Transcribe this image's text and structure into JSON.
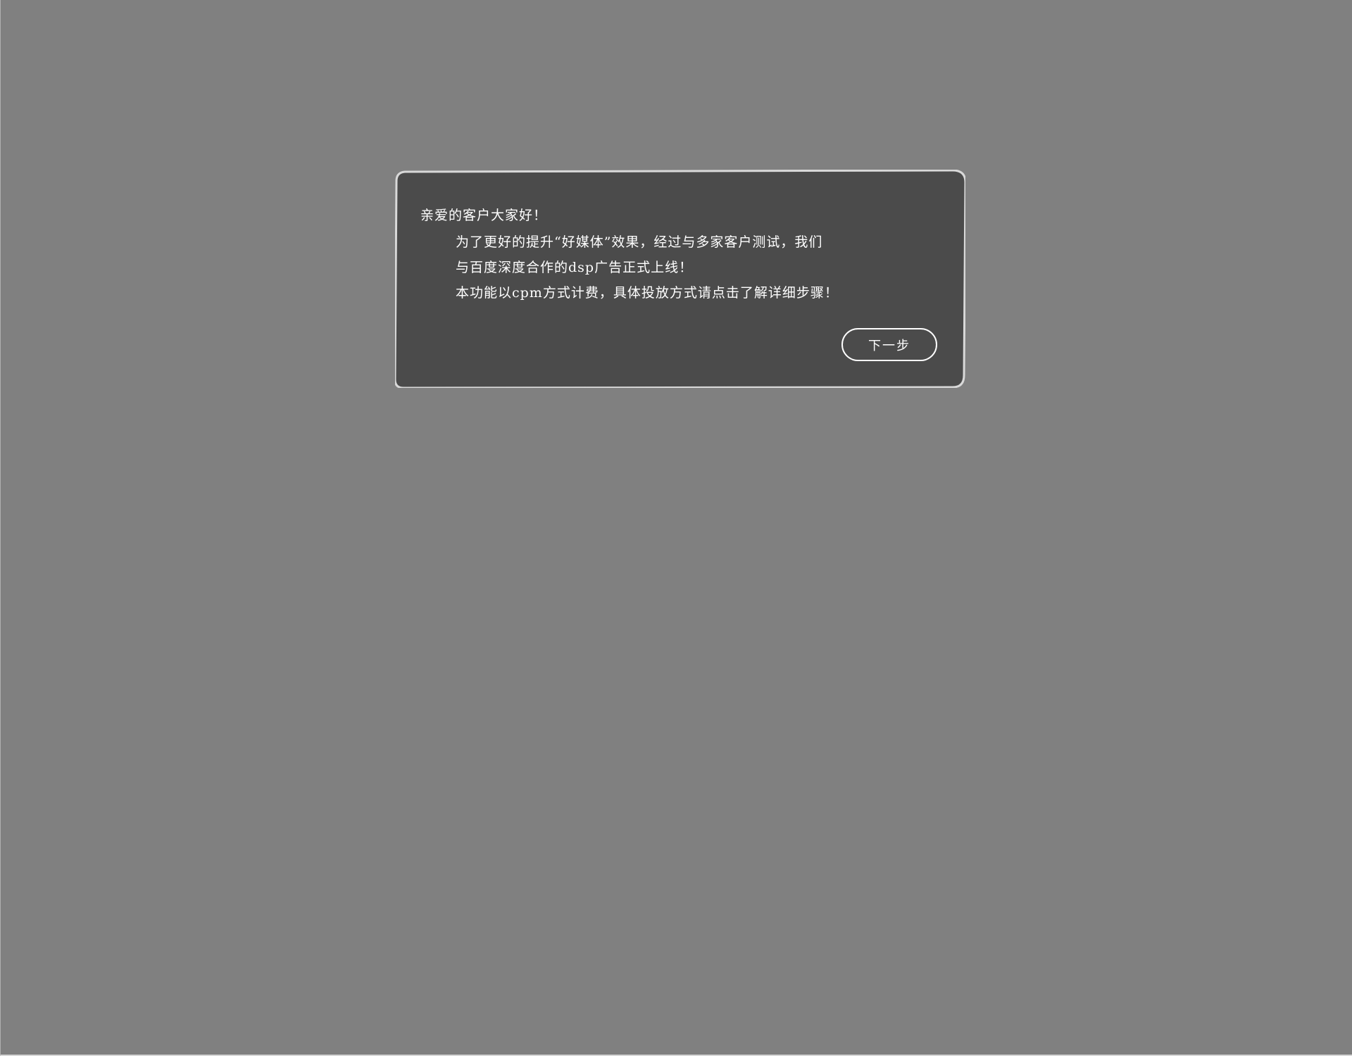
{
  "colors": {
    "page_background": "#808080",
    "dialog_background": "#4b4b4b",
    "dialog_border": "#d9d9d9",
    "text": "#ffffff"
  },
  "dialog": {
    "greeting": "亲爱的客户大家好！",
    "lines": [
      "为了更好的提升“好媒体”效果，经过与多家客户测试，我们",
      "与百度深度合作的dsp广告正式上线！",
      "本功能以cpm方式计费，具体投放方式请点击了解详细步骤！"
    ],
    "next_label": "下一步"
  }
}
